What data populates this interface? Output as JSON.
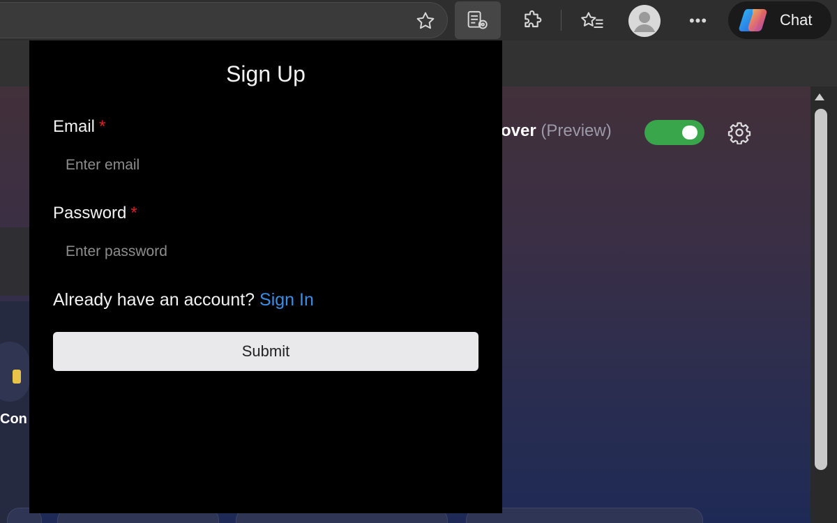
{
  "toolbar": {
    "chat_label": "Chat",
    "more_glyph": "•••"
  },
  "background": {
    "discover_partial": "over",
    "preview_label": "(Preview)",
    "left_partial_text": "Con",
    "toggle_on": true
  },
  "signup": {
    "title": "Sign Up",
    "email_label": "Email",
    "email_required": "*",
    "email_placeholder": "Enter email",
    "email_value": "",
    "password_label": "Password",
    "password_required": "*",
    "password_placeholder": "Enter password",
    "password_value": "",
    "account_prompt": "Already have an account?",
    "signin_link": "Sign In",
    "submit_label": "Submit"
  },
  "colors": {
    "panel_bg": "#000000",
    "link": "#3a8ee6",
    "required": "#e02020",
    "toggle_on": "#3aa64b",
    "submit_bg": "#e9e9ec"
  },
  "icons": {
    "toolbar": [
      "star-icon",
      "reader-mode-icon",
      "extensions-icon",
      "favorites-icon",
      "profile-icon",
      "more-icon",
      "copilot-icon"
    ],
    "page": [
      "gear-icon"
    ]
  }
}
